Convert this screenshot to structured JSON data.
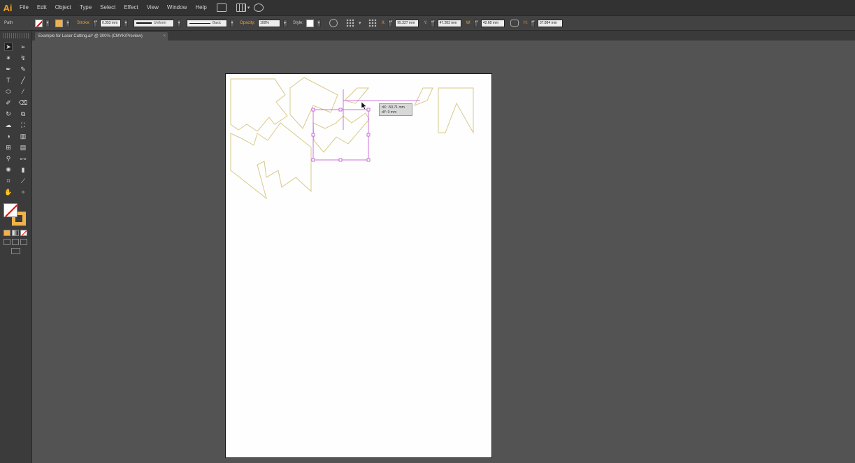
{
  "app": {
    "logo": "Ai",
    "menus": [
      "File",
      "Edit",
      "Object",
      "Type",
      "Select",
      "Effect",
      "View",
      "Window",
      "Help"
    ]
  },
  "control_bar": {
    "object_type": "Path",
    "stroke_label": "Stroke:",
    "stroke_weight": "0.353 mm",
    "profile": "Uniform",
    "brush": "Basic",
    "opacity_label": "Opacity:",
    "opacity_value": "100%",
    "style_label": "Style:",
    "x_label": "X:",
    "x_value": "95.327 mm",
    "y_label": "Y:",
    "y_value": "47.283 mm",
    "w_label": "W:",
    "w_value": "42.68 mm",
    "h_label": "H:",
    "h_value": "37.884 mm"
  },
  "document_tab": {
    "title": "Example for Laser Cutting.ai* @ 300% (CMYK/Preview)",
    "close": "×"
  },
  "tools": {
    "icons": [
      "selection-icon",
      "direct-selection-icon",
      "magic-wand-icon",
      "lasso-icon",
      "pen-icon",
      "curvature-icon",
      "type-icon",
      "line-icon",
      "ellipse-icon",
      "paintbrush-icon",
      "blob-brush-icon",
      "eraser-icon",
      "rotate-icon",
      "scale-icon",
      "warp-icon",
      "free-transform-icon",
      "shape-builder-icon",
      "perspective-icon",
      "mesh-icon",
      "gradient-icon",
      "eyedropper-icon",
      "blend-icon",
      "symbol-sprayer-icon",
      "graph-icon",
      "artboard-icon",
      "slice-icon",
      "hand-icon",
      "zoom-icon"
    ],
    "fill": "none",
    "stroke_color": "#f2b24a"
  },
  "canvas": {
    "tooltip_dx": "dX: -50.71 mm",
    "tooltip_dy": "dY: 0 mm"
  },
  "colors": {
    "shape_stroke": "#d8c98a",
    "selection": "#c04fd0",
    "accent": "#f7a21b"
  }
}
